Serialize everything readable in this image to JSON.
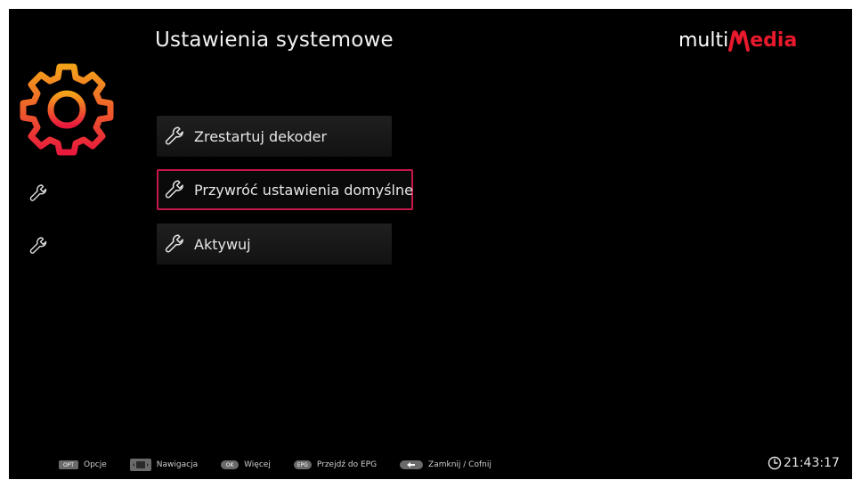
{
  "header": {
    "title": "Ustawienia systemowe",
    "logo": {
      "prefix": "multi",
      "accent": "edia",
      "accent_color": "#e8192c"
    }
  },
  "sidebar": {
    "icon": "gear-icon",
    "items": [
      {
        "icon": "wrench-icon"
      },
      {
        "icon": "wrench-icon"
      }
    ]
  },
  "menu": {
    "items": [
      {
        "label": "Zrestartuj dekoder",
        "icon": "wrench-icon",
        "selected": false
      },
      {
        "label": "Przywróć ustawienia domyślne",
        "icon": "wrench-icon",
        "selected": true
      },
      {
        "label": "Aktywuj",
        "icon": "wrench-icon",
        "selected": false
      }
    ],
    "selection_color": "#c8174a"
  },
  "footer": {
    "hints": [
      {
        "key": "OPT",
        "label": "Opcje"
      },
      {
        "key": "",
        "label": "Nawigacja"
      },
      {
        "key": "OK",
        "label": "Więcej"
      },
      {
        "key": "EPG",
        "label": "Przejdź do EPG"
      },
      {
        "key": "",
        "label": "Zamknij / Cofnij"
      }
    ],
    "clock": "21:43:17"
  }
}
